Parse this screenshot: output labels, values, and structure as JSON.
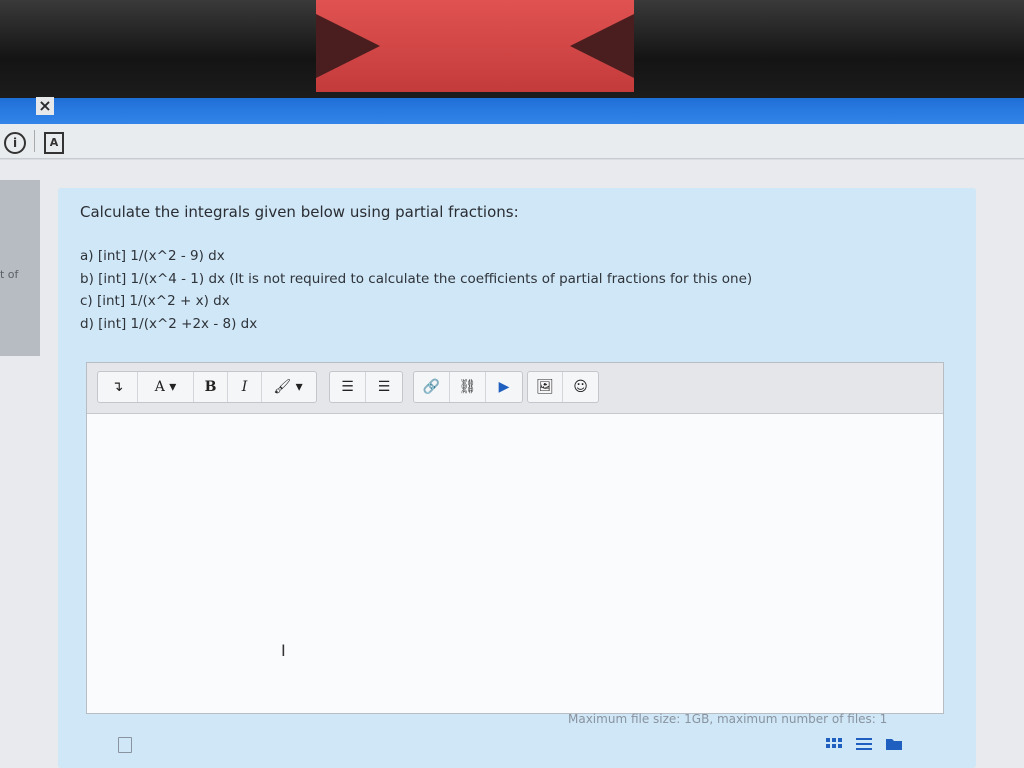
{
  "window": {
    "close_glyph": "×"
  },
  "toolbar_icons": [
    "info-icon",
    "pdf-icon"
  ],
  "left_nav": {
    "label": "t of"
  },
  "question": {
    "title": "Calculate the integrals given below using partial fractions:",
    "items": [
      "a) [int] 1/(x^2 - 9) dx",
      "b) [int] 1/(x^4 - 1) dx  (It is not required to calculate the coefficients of partial fractions for this one)",
      "c) [int] 1/(x^2 + x) dx",
      "d) [int] 1/(x^2 +2x - 8) dx"
    ]
  },
  "editor": {
    "toolbar": {
      "collapse": "↴",
      "font": "A ▾",
      "bold": "B",
      "italic": "I",
      "brush": "🖌 ▾",
      "bullet_list": "☰",
      "numbered_list": "☰",
      "link": "🔗",
      "unlink": "⛓",
      "media": "▶",
      "image": "🖼",
      "emoji": "☺"
    },
    "value": ""
  },
  "footer": {
    "max_size_text": "Maximum file size: 1GB, maximum number of files: 1"
  },
  "colors": {
    "card": "#cfe7f6",
    "blue_bar": "#2b7ee6"
  }
}
